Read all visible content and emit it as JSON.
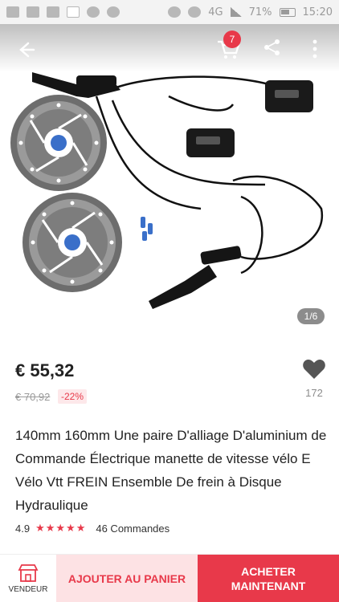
{
  "status_bar": {
    "network": "4G",
    "battery_percent": "71%",
    "time": "15:20"
  },
  "header": {
    "cart_count": "7",
    "icons": [
      "back-arrow-icon",
      "cart-icon",
      "share-icon",
      "more-vertical-icon"
    ]
  },
  "gallery": {
    "page_indicator": "1/6"
  },
  "product": {
    "price": "€ 55,32",
    "old_price": "€ 70,92",
    "discount": "-22%",
    "wishlist_count": "172",
    "title": "140mm 160mm Une paire D'alliage D'aluminium de Commande Électrique manette de vitesse vélo E Vélo Vtt FREIN Ensemble De frein à Disque Hydraulique",
    "rating": "4.9",
    "rating_stars": 5,
    "orders": "46 Commandes"
  },
  "bottom_bar": {
    "seller_label": "VENDEUR",
    "add_to_cart": "AJOUTER AU PANIER",
    "buy_now": "ACHETER MAINTENANT"
  },
  "colors": {
    "accent": "#e8394a",
    "accent_light": "#fde2e4"
  }
}
